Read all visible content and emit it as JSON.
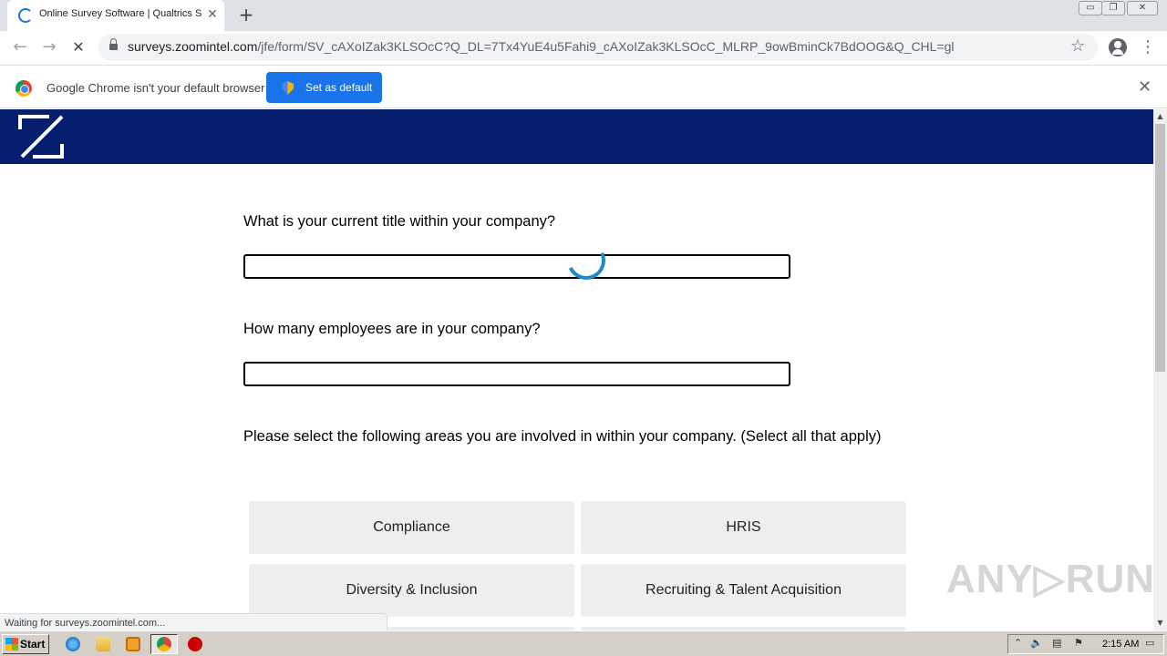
{
  "browser": {
    "tab_title": "Online Survey Software | Qualtrics S",
    "tab_close": "✕",
    "new_tab": "+",
    "url_host": "surveys.zoomintel.com",
    "url_path": "/jfe/form/SV_cAXoIZak3KLSOcC?Q_DL=7Tx4YuE4u5Fahi9_cAXoIZak3KLSOcC_MLRP_9owBminCk7BdOOG&Q_CHL=gl",
    "back": "←",
    "forward": "→",
    "stop": "✕",
    "star": "☆",
    "menu": "⋮",
    "window_buttons": [
      "▭",
      "❐",
      "✕"
    ]
  },
  "infobar": {
    "message": "Google Chrome isn't your default browser",
    "button_label": "Set as default",
    "close": "✕"
  },
  "survey": {
    "brand_color": "#051e6e",
    "q1": "What is your current title within your company?",
    "q2": "How many employees are in your company?",
    "q3": "Please select the following areas you are involved in within your company. (Select all that apply)",
    "choices": [
      "Compliance",
      "HRIS",
      "Diversity & Inclusion",
      "Recruiting & Talent Acquisition"
    ]
  },
  "status": "Waiting for surveys.zoomintel.com...",
  "watermark": "ANY▷RUN",
  "taskbar": {
    "start": "Start",
    "clock": "2:15 AM",
    "icons": [
      "ie-icon",
      "folder-icon",
      "media-player-icon",
      "chrome-icon",
      "stop-icon"
    ]
  }
}
